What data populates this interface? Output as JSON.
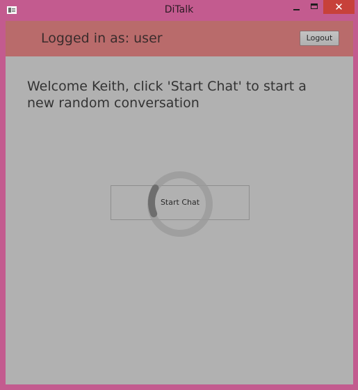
{
  "window": {
    "title": "DiTalk",
    "close_glyph": "✕"
  },
  "header": {
    "login_label": "Logged in as: user",
    "logout_label": "Logout"
  },
  "main": {
    "welcome_text": "Welcome Keith, click 'Start Chat' to start a new random conversation",
    "start_chat_label": "Start Chat",
    "loading": true
  },
  "colors": {
    "frame": "#c35b8f",
    "header_bar": "#b96b6b",
    "content_bg": "#b1b1b1",
    "close_button": "#c7413a"
  },
  "icons": {
    "app": "app-icon",
    "minimize": "minimize-icon",
    "maximize": "maximize-icon",
    "close": "close-icon",
    "spinner": "loading-spinner-icon"
  }
}
